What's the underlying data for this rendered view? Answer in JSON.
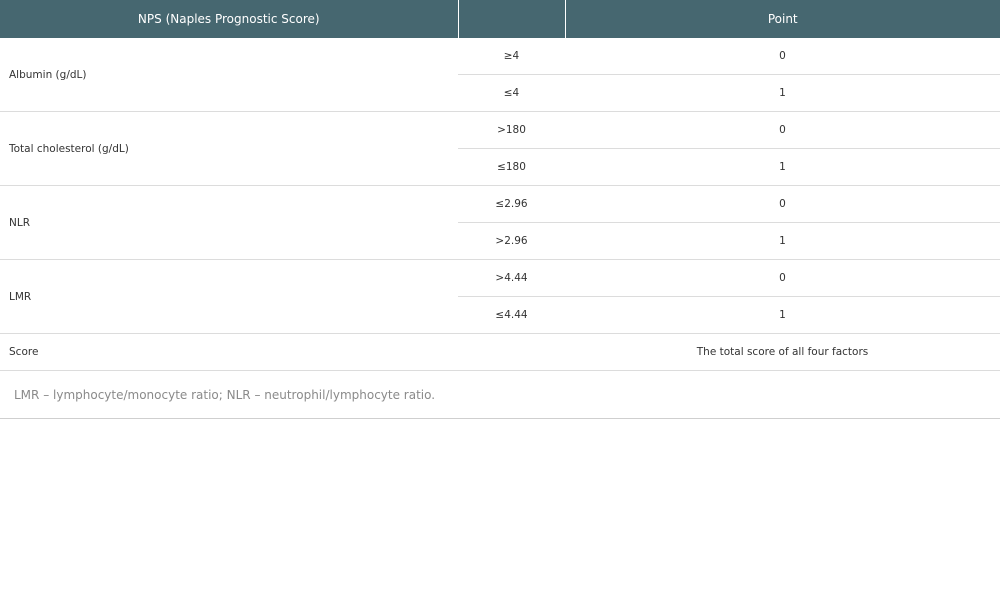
{
  "table": {
    "headers": [
      "NPS (Naples Prognostic Score)",
      "",
      "Point"
    ],
    "groups": [
      {
        "label": "Albumin (g/dL)",
        "rows": [
          {
            "condition": "≥4",
            "point": "0"
          },
          {
            "condition": "≤4",
            "point": "1"
          }
        ]
      },
      {
        "label": "Total cholesterol (g/dL)",
        "rows": [
          {
            "condition": ">180",
            "point": "0"
          },
          {
            "condition": "≤180",
            "point": "1"
          }
        ]
      },
      {
        "label": "NLR",
        "rows": [
          {
            "condition": "≤2.96",
            "point": "0"
          },
          {
            "condition": ">2.96",
            "point": "1"
          }
        ]
      },
      {
        "label": "LMR",
        "rows": [
          {
            "condition": ">4.44",
            "point": "0"
          },
          {
            "condition": "≤4.44",
            "point": "1"
          }
        ]
      }
    ],
    "score_row": {
      "label": "Score",
      "condition": "",
      "point": "The total score of all four factors"
    }
  },
  "footnote": "LMR – lymphocyte/monocyte ratio; NLR – neutrophil/lymphocyte ratio."
}
